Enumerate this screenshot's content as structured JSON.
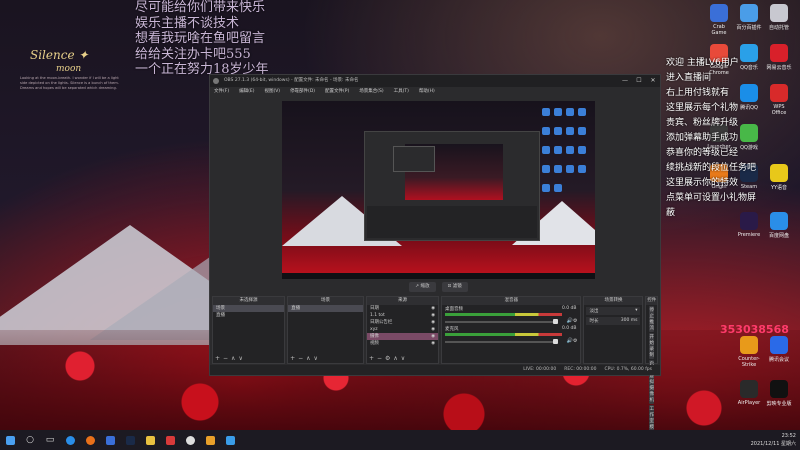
{
  "overlay": {
    "lines": [
      "尽可能给你们带来快乐",
      "娱乐主播不谈技术",
      "想看我玩啥在鱼吧留言",
      "给给关注办卡吧555",
      "一个正在努力18岁少年"
    ],
    "logo_line1": "Silence ✦",
    "logo_line2": "moon",
    "logo_desc": "Looking at the moon-breath. I wonder if I will be a light side depicted on the lights. Silence is a bunch of them. Dreams and hopes will be separated which dreaming."
  },
  "desktop": {
    "icons": [
      {
        "label": "Crab Game",
        "color": "#3a6fd8"
      },
      {
        "label": "百分百插件",
        "color": "#4a9de8"
      },
      {
        "label": "自动托管",
        "color": "#c8c8d0"
      },
      {
        "label": "Google Chrome",
        "color": "#e84a3a"
      },
      {
        "label": "QQ音乐",
        "color": "#2aa0e8"
      },
      {
        "label": "网易云音乐",
        "color": "#d8202a"
      },
      {
        "label": "腾讯QQ",
        "color": "#1a8ee8"
      },
      {
        "label": "WPS Office",
        "color": "#d82a2a"
      },
      {
        "label": "Launcher",
        "color": "#3a3a3a"
      },
      {
        "label": "QQ游戏",
        "color": "#48b848"
      },
      {
        "label": "Origin",
        "color": "#e87a1a"
      },
      {
        "label": "Steam",
        "color": "#1a2a48"
      },
      {
        "label": "YY语音",
        "color": "#e8c81a"
      },
      {
        "label": "Premiere",
        "color": "#2a1a48"
      },
      {
        "label": "百度网盘",
        "color": "#2a8ee8"
      },
      {
        "label": "Counter-Strike",
        "color": "#e89a1a"
      },
      {
        "label": "腾讯会议",
        "color": "#2a6ae8"
      },
      {
        "label": "AirPlayer",
        "color": "#2a2a2a"
      },
      {
        "label": "剪映专业版",
        "color": "#111111"
      }
    ],
    "alerts": [
      "欢迎 主播LV6用户",
      "进入直播间",
      "右上用付钱就有",
      "这里展示每个礼物",
      "贵宾、粉丝牌升级",
      "添加弹幕助手成功",
      "恭喜你的等级已经",
      "续挑战新的段位任务吧",
      "这里展示你的特效",
      "点菜单可设置小礼物屏蔽"
    ],
    "stat_number": "353038568"
  },
  "obs": {
    "title": "OBS 27.1.3 (64-bit, windows) - 配置文件: 未命名 - 场景: 未命名",
    "menu": [
      "文件(F)",
      "编辑(E)",
      "视图(V)",
      "停靠部件(D)",
      "配置文件(P)",
      "场景集合(S)",
      "工具(T)",
      "帮助(H)"
    ],
    "controls": [
      "↗ 缩放",
      "⊡ 滤镜"
    ],
    "scenes_title": "场景",
    "scenes": [
      "场景",
      "直播"
    ],
    "selected_source_label": "未选择源",
    "sources_title": "来源",
    "sources": [
      "日期",
      "1.1 tot",
      "日期公告栏",
      "xyz",
      "摄像",
      "视频"
    ],
    "mixer_title": "混音器",
    "mixer": [
      {
        "name": "桌面音频",
        "level": "0.0 dB"
      },
      {
        "name": "麦克风",
        "level": "0.0 dB"
      }
    ],
    "transitions_title": "场景转换",
    "transition_type": "淡出",
    "duration_label": "时长",
    "duration_value": "300 ms",
    "controls_title": "控件",
    "control_buttons": [
      "停止推流",
      "开始录制",
      "启动虚拟摄像机",
      "工作室模式",
      "设置",
      "退出"
    ],
    "status": [
      "LIVE: 00:00:00",
      "REC: 00:00:00",
      "CPU: 0.7%, 60.00 fps"
    ]
  },
  "taskbar": {
    "time": "23:52",
    "date": "2021/12/11 星期六"
  }
}
